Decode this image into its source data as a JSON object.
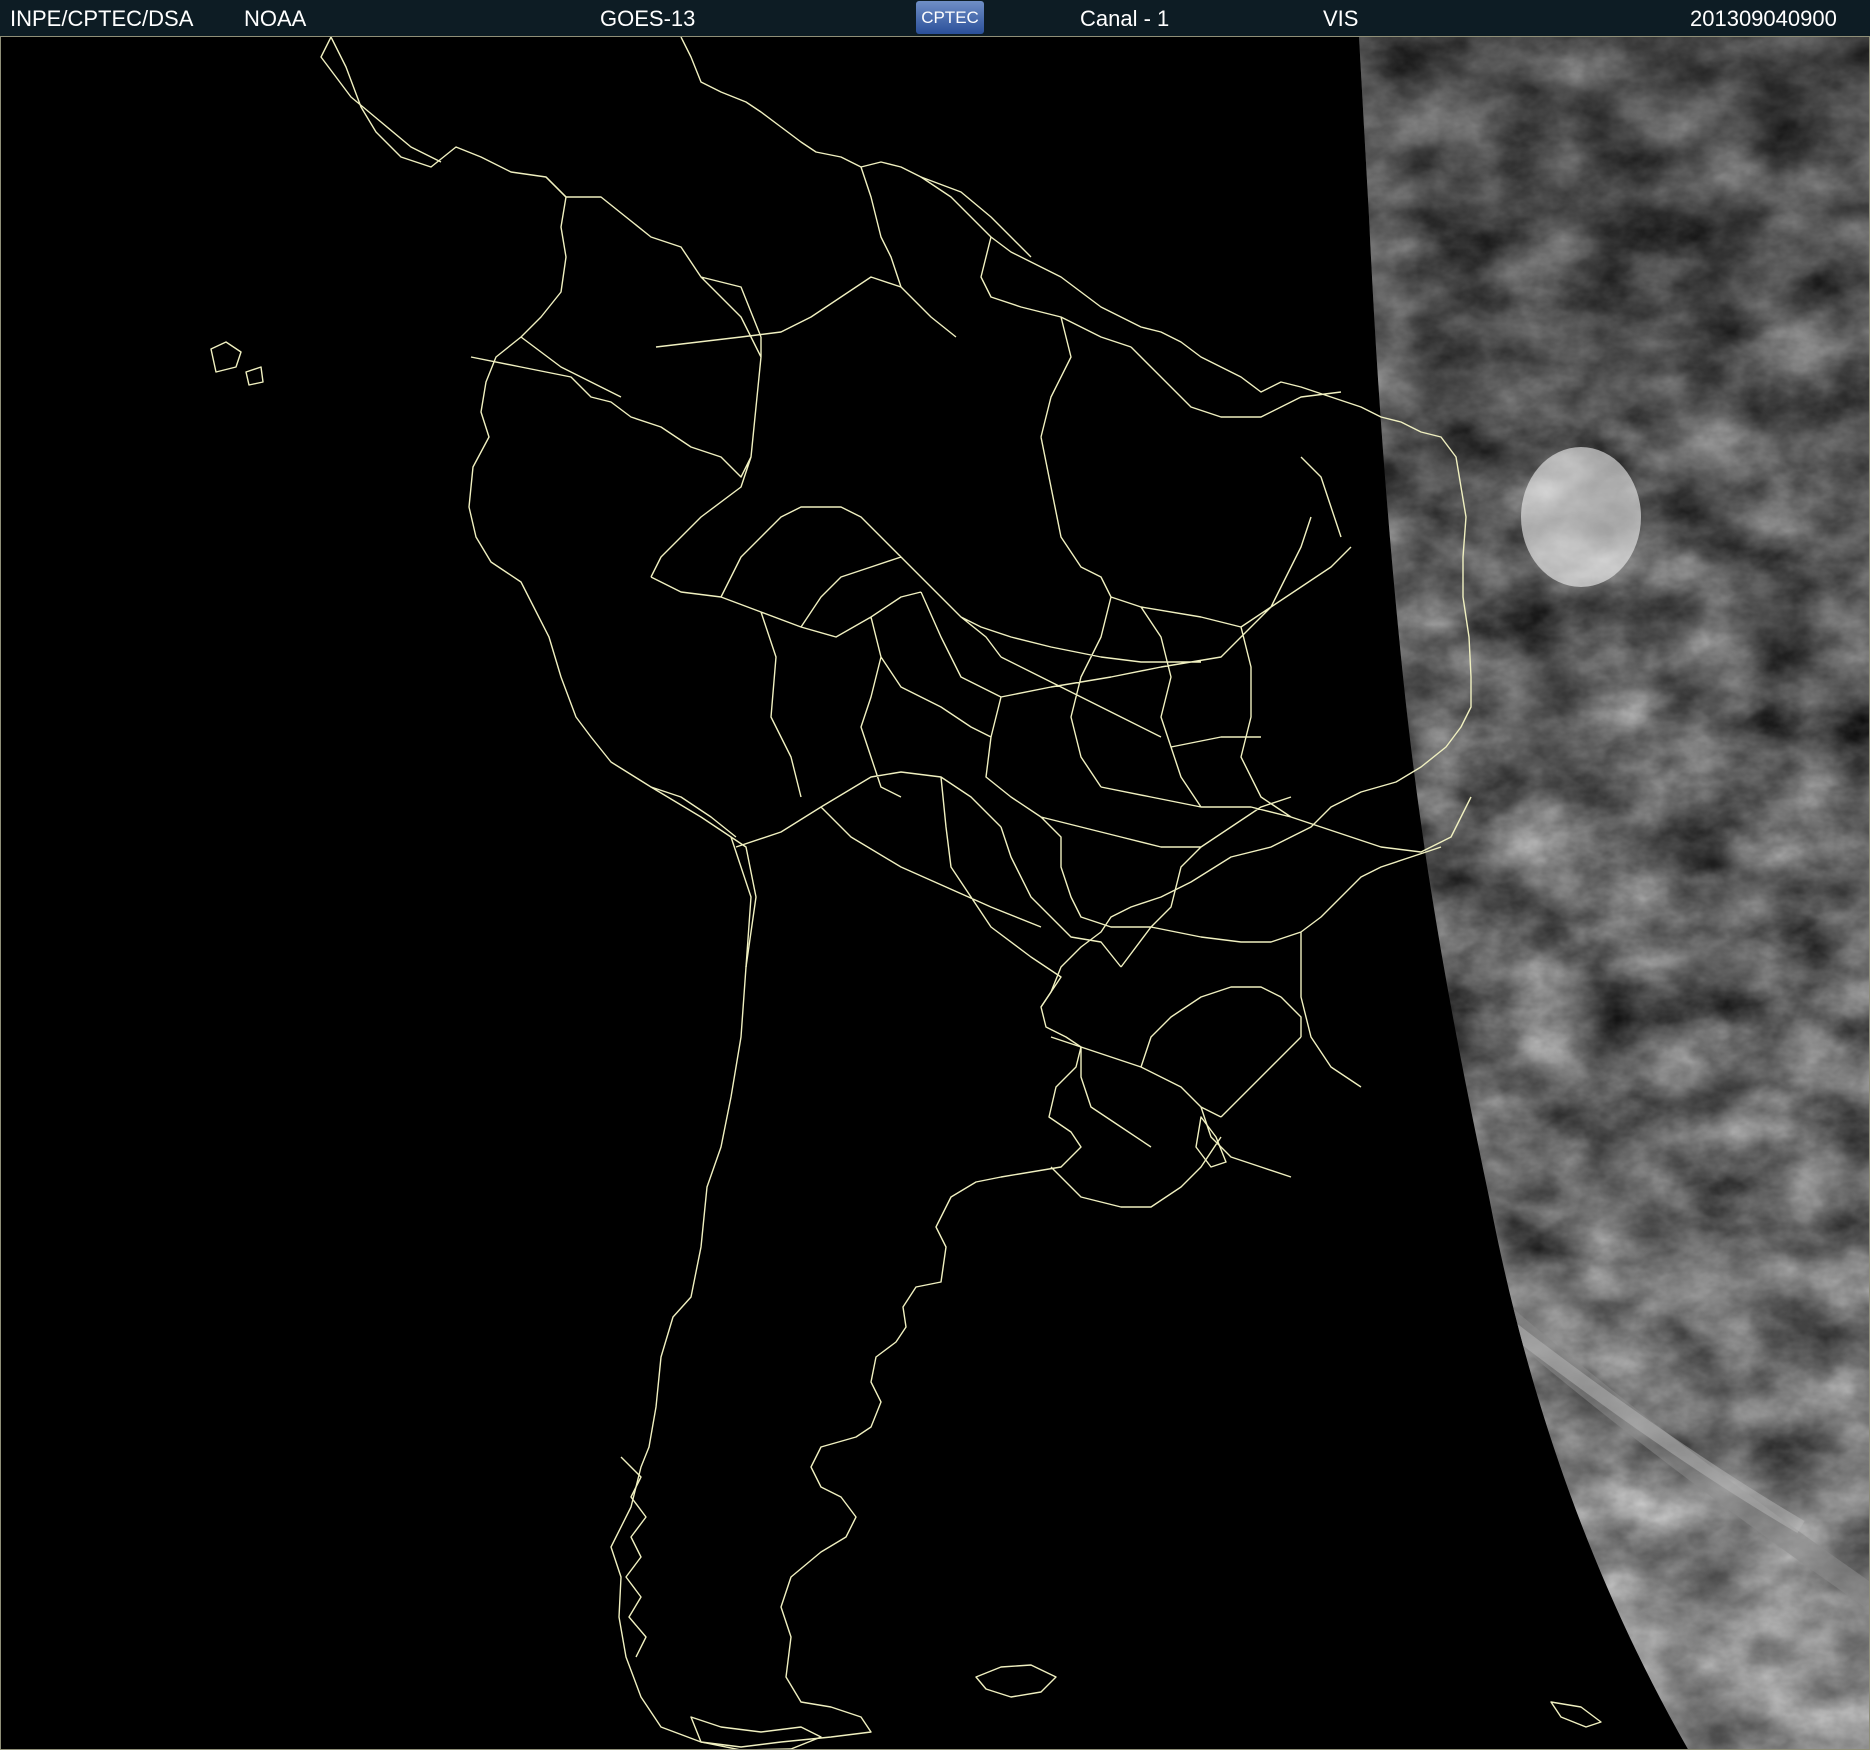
{
  "header": {
    "agency": "INPE/CPTEC/DSA",
    "source": "NOAA",
    "satellite": "GOES-13",
    "logo_text": "CPTEC",
    "channel": "Canal - 1",
    "band": "VIS",
    "timestamp": "201309040900"
  },
  "colors": {
    "header_bg": "#0d1c24",
    "map_bg": "#000000",
    "boundary": "#f0f0c0",
    "cloud_light": "#e8e8e8",
    "cloud_dark": "#6a6a6a"
  },
  "map": {
    "region": "South America",
    "lit_side": "east (right) — daylight terminator crossing the Atlantic"
  }
}
